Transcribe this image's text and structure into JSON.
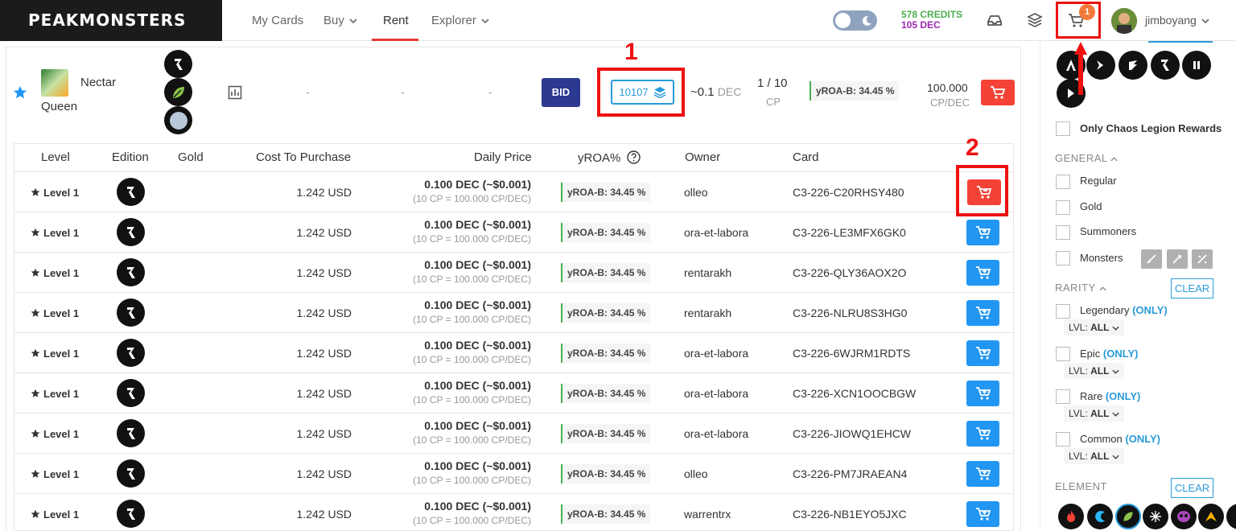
{
  "brand": {
    "name": "PEAKMONSTERS"
  },
  "nav": {
    "my_cards": "My Cards",
    "buy": "Buy",
    "rent": "Rent",
    "explorer": "Explorer"
  },
  "account": {
    "credits": "578 CREDITS",
    "dec": "105 DEC",
    "cart_count": "1",
    "username": "jimboyang"
  },
  "summary": {
    "card_name_line1": "Nectar",
    "card_name_line2": "Queen",
    "dash1": "-",
    "dash2": "-",
    "dash3": "-",
    "bid_label": "BID",
    "listing_count": "10107",
    "approx_price": "~0.1",
    "approx_unit": "DEC",
    "cp_fraction": "1 / 10",
    "cp_label": "CP",
    "yroa": "yROA-B: 34.45 %",
    "price": "100.000",
    "price_unit": "CP/DEC"
  },
  "annotations": {
    "label1": "1",
    "label2": "2"
  },
  "table": {
    "headers": {
      "level": "Level",
      "edition": "Edition",
      "gold": "Gold",
      "cost": "Cost To Purchase",
      "daily": "Daily Price",
      "yroa": "yROA%",
      "owner": "Owner",
      "card": "Card"
    },
    "rows": [
      {
        "level": "Level 1",
        "cost": "1.242 USD",
        "daily": "0.100 DEC (~$0.001)",
        "daily_sub": "(10 CP = 100.000 CP/DEC)",
        "yroa": "yROA-B: 34.45 %",
        "owner": "olleo",
        "card": "C3-226-C20RHSY480"
      },
      {
        "level": "Level 1",
        "cost": "1.242 USD",
        "daily": "0.100 DEC (~$0.001)",
        "daily_sub": "(10 CP = 100.000 CP/DEC)",
        "yroa": "yROA-B: 34.45 %",
        "owner": "ora-et-labora",
        "card": "C3-226-LE3MFX6GK0"
      },
      {
        "level": "Level 1",
        "cost": "1.242 USD",
        "daily": "0.100 DEC (~$0.001)",
        "daily_sub": "(10 CP = 100.000 CP/DEC)",
        "yroa": "yROA-B: 34.45 %",
        "owner": "rentarakh",
        "card": "C3-226-QLY36AOX2O"
      },
      {
        "level": "Level 1",
        "cost": "1.242 USD",
        "daily": "0.100 DEC (~$0.001)",
        "daily_sub": "(10 CP = 100.000 CP/DEC)",
        "yroa": "yROA-B: 34.45 %",
        "owner": "rentarakh",
        "card": "C3-226-NLRU8S3HG0"
      },
      {
        "level": "Level 1",
        "cost": "1.242 USD",
        "daily": "0.100 DEC (~$0.001)",
        "daily_sub": "(10 CP = 100.000 CP/DEC)",
        "yroa": "yROA-B: 34.45 %",
        "owner": "ora-et-labora",
        "card": "C3-226-6WJRM1RDTS"
      },
      {
        "level": "Level 1",
        "cost": "1.242 USD",
        "daily": "0.100 DEC (~$0.001)",
        "daily_sub": "(10 CP = 100.000 CP/DEC)",
        "yroa": "yROA-B: 34.45 %",
        "owner": "ora-et-labora",
        "card": "C3-226-XCN1OOCBGW"
      },
      {
        "level": "Level 1",
        "cost": "1.242 USD",
        "daily": "0.100 DEC (~$0.001)",
        "daily_sub": "(10 CP = 100.000 CP/DEC)",
        "yroa": "yROA-B: 34.45 %",
        "owner": "ora-et-labora",
        "card": "C3-226-JIOWQ1EHCW"
      },
      {
        "level": "Level 1",
        "cost": "1.242 USD",
        "daily": "0.100 DEC (~$0.001)",
        "daily_sub": "(10 CP = 100.000 CP/DEC)",
        "yroa": "yROA-B: 34.45 %",
        "owner": "olleo",
        "card": "C3-226-PM7JRAEAN4"
      },
      {
        "level": "Level 1",
        "cost": "1.242 USD",
        "daily": "0.100 DEC (~$0.001)",
        "daily_sub": "(10 CP = 100.000 CP/DEC)",
        "yroa": "yROA-B: 34.45 %",
        "owner": "warrentrx",
        "card": "C3-226-NB1EYO5JXC"
      }
    ]
  },
  "sidebar": {
    "chaos_legion": "Only Chaos Legion Rewards",
    "general_title": "GENERAL",
    "regular": "Regular",
    "gold": "Gold",
    "summoners": "Summoners",
    "monsters": "Monsters",
    "rarity_title": "RARITY",
    "clear": "CLEAR",
    "legendary": "Legendary",
    "epic": "Epic",
    "rare": "Rare",
    "common": "Common",
    "only": "(ONLY)",
    "lvl_prefix": "LVL:",
    "lvl_value": "ALL",
    "element_title": "ELEMENT"
  },
  "colors": {
    "accent_blue": "#2196f3",
    "danger_red": "#f44336",
    "bid_navy": "#2b3990",
    "credits_green": "#4caf50",
    "dec_purple": "#9c27b0"
  }
}
